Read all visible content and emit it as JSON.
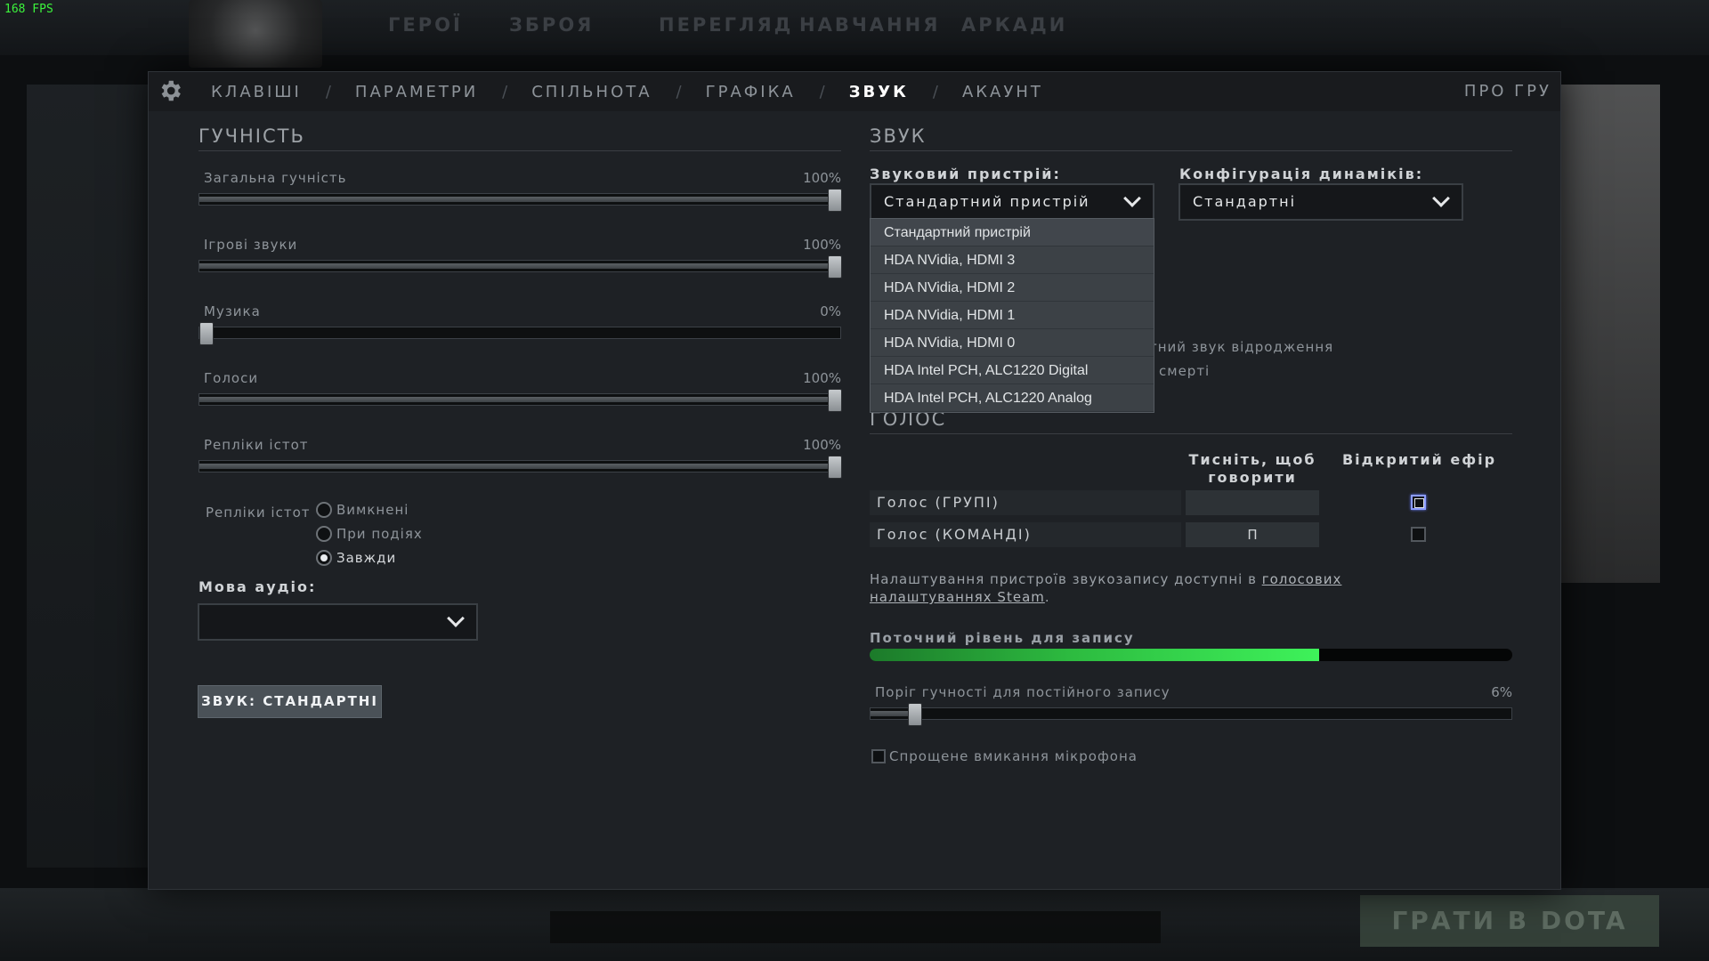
{
  "fps": "168 FPS",
  "background": {
    "nav": [
      "ГЕРОЇ",
      "ЗБРОЯ",
      "ПЕРЕГЛЯД",
      "НАВЧАННЯ",
      "АРКАДИ"
    ],
    "play_button": "ГРАТИ В DOTA"
  },
  "tabs": [
    {
      "label": "КЛАВІШІ"
    },
    {
      "label": "ПАРАМЕТРИ"
    },
    {
      "label": "СПІЛЬНОТА"
    },
    {
      "label": "ГРАФІКА"
    },
    {
      "label": "ЗВУК",
      "active": true
    },
    {
      "label": "АКАУНТ"
    }
  ],
  "tab_separator": "/",
  "about_tab": "ПРО ГРУ",
  "volume": {
    "title": "ГУЧНІСТЬ",
    "sliders": [
      {
        "label": "Загальна гучність",
        "value_text": "100%",
        "value": 100
      },
      {
        "label": "Ігрові звуки",
        "value_text": "100%",
        "value": 100
      },
      {
        "label": "Музика",
        "value_text": "0%",
        "value": 0
      },
      {
        "label": "Голоси",
        "value_text": "100%",
        "value": 100
      },
      {
        "label": "Репліки істот",
        "value_text": "100%",
        "value": 100
      }
    ],
    "creature_lines_label": "Репліки істот",
    "creature_options": [
      {
        "label": "Вимкнені",
        "selected": false
      },
      {
        "label": "При подіях",
        "selected": false
      },
      {
        "label": "Завжди",
        "selected": true
      }
    ],
    "audio_language_label": "Мова аудіо:",
    "audio_language_value": "",
    "default_button": "ЗВУК: СТАНДАРТНІ"
  },
  "sound": {
    "title": "ЗВУК",
    "device_label": "Звуковий пристрій:",
    "device_value": "Стандартний пристрій",
    "speaker_label": "Конфігурація динаміків:",
    "speaker_value": "Стандартні",
    "device_options": [
      "Стандартний пристрій",
      "HDA NVidia, HDMI 3",
      "HDA NVidia, HDMI 2",
      "HDA NVidia, HDMI 1",
      "HDA NVidia, HDMI 0",
      "HDA Intel PCH, ALC1220 Digital",
      "HDA Intel PCH, ALC1220 Analog"
    ],
    "partial_option_1": "тний звук відродження",
    "partial_option_2": "смерті"
  },
  "voice": {
    "title": "ГОЛОС",
    "col_push_to_talk": "Тисніть, щоб говорити",
    "col_open_mic": "Відкритий ефір",
    "rows": [
      {
        "label": "Голос (ГРУПІ)",
        "key": "",
        "open_mic": false
      },
      {
        "label": "Голос (КОМАНДІ)",
        "key": "П",
        "open_mic": false
      }
    ],
    "info_prefix": "Налаштування пристроїв звукозапису доступні в ",
    "info_link": "голосових налаштуваннях Steam",
    "info_suffix": ".",
    "record_level_label": "Поточний рівень для запису",
    "record_level": 0.7,
    "threshold_label": "Поріг гучності для постійного запису",
    "threshold_value_text": "6%",
    "threshold_value": 6,
    "simple_mic_label": "Спрощене вмикання мікрофона",
    "simple_mic_checked": false
  }
}
